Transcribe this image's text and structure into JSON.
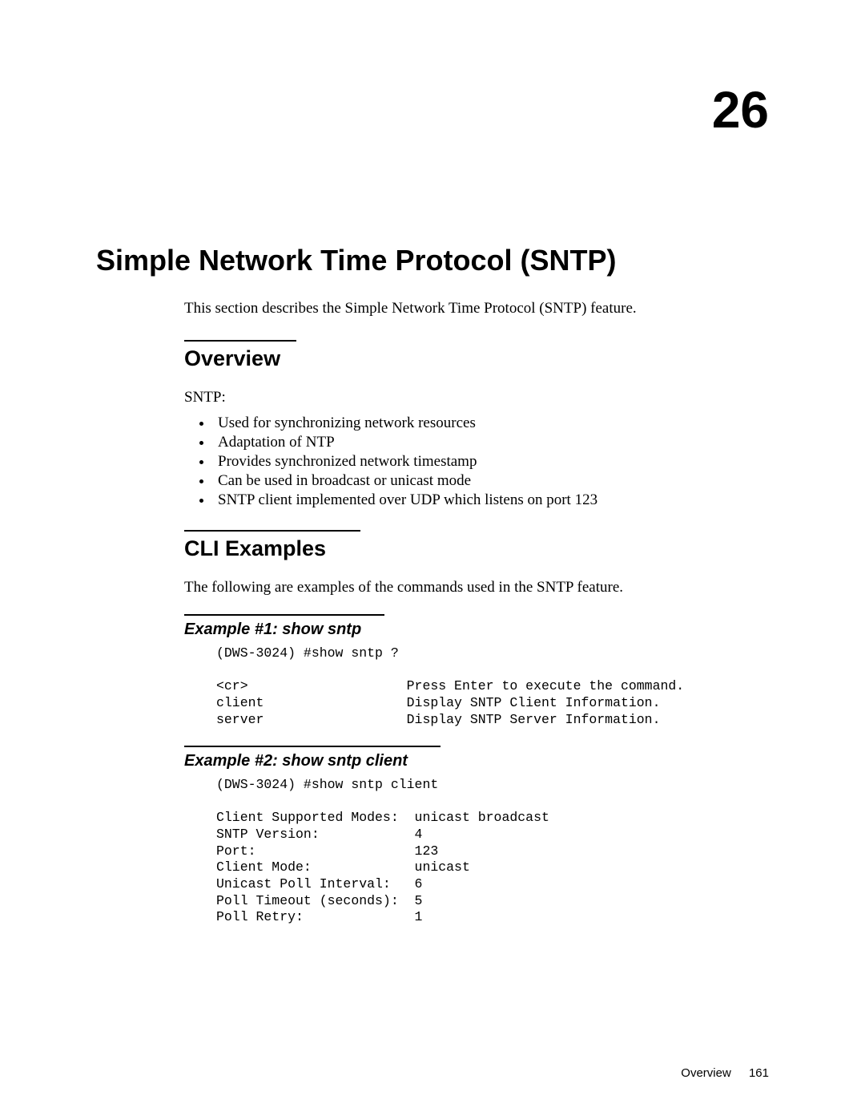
{
  "chapter": {
    "number": "26",
    "title": "Simple Network Time Protocol (SNTP)",
    "intro": "This section describes the Simple Network Time Protocol (SNTP) feature."
  },
  "overview": {
    "heading": "Overview",
    "subhead": "SNTP:",
    "bullets": [
      "Used for synchronizing network resources",
      "Adaptation of NTP",
      "Provides synchronized network timestamp",
      "Can be used in broadcast or unicast mode",
      "SNTP client implemented over UDP which listens on port 123"
    ]
  },
  "cli": {
    "heading": "CLI Examples",
    "intro": "The following are examples of the commands used in the SNTP feature.",
    "example1": {
      "heading": "Example #1: show sntp",
      "code": "(DWS-3024) #show sntp ?\n\n<cr>                    Press Enter to execute the command.\nclient                  Display SNTP Client Information.\nserver                  Display SNTP Server Information."
    },
    "example2": {
      "heading": "Example #2: show sntp client",
      "code": "(DWS-3024) #show sntp client\n\nClient Supported Modes:  unicast broadcast\nSNTP Version:            4\nPort:                    123\nClient Mode:             unicast\nUnicast Poll Interval:   6\nPoll Timeout (seconds):  5\nPoll Retry:              1"
    }
  },
  "footer": {
    "label": "Overview",
    "page": "161"
  }
}
